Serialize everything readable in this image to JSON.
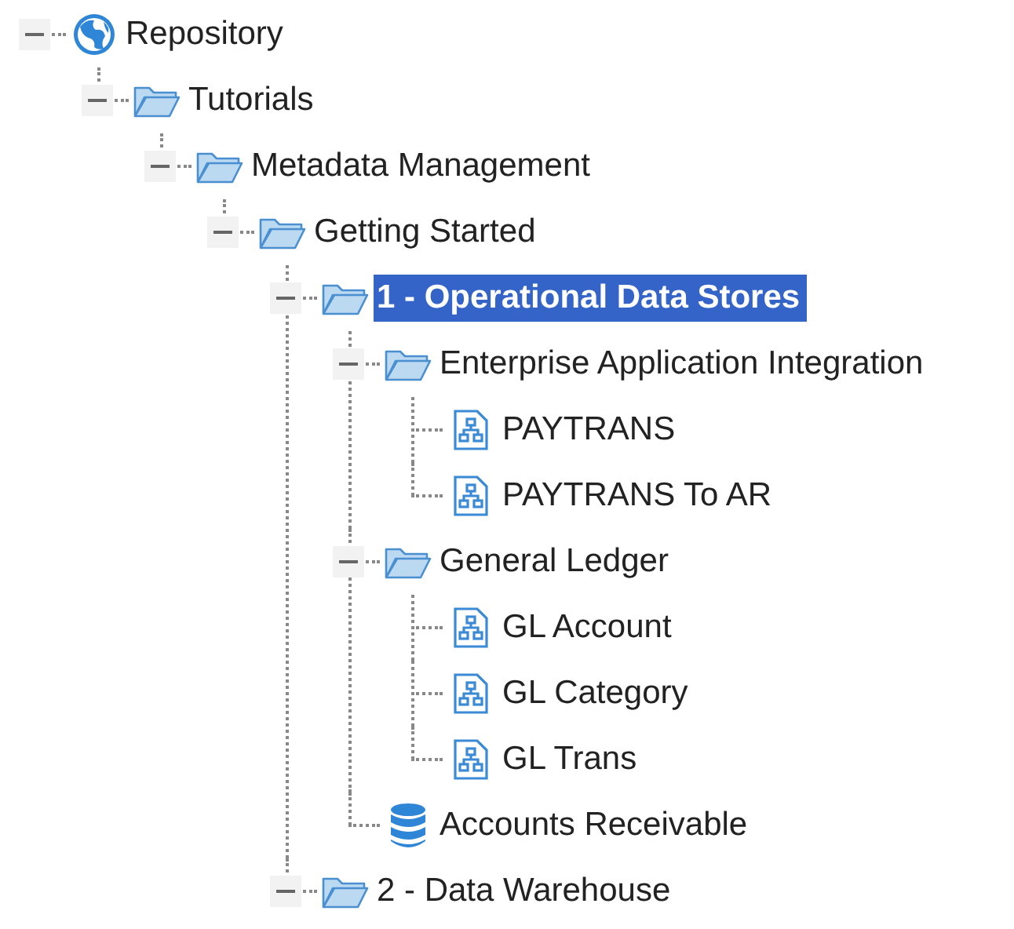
{
  "tree": [
    {
      "label": "Repository",
      "kind": "globe",
      "expanded": true,
      "selected": false,
      "children": [
        {
          "label": "Tutorials",
          "kind": "folder",
          "expanded": true,
          "selected": false,
          "children": [
            {
              "label": "Metadata Management",
              "kind": "folder",
              "expanded": true,
              "selected": false,
              "children": [
                {
                  "label": "Getting Started",
                  "kind": "folder",
                  "expanded": true,
                  "selected": false,
                  "children": [
                    {
                      "label": "1 - Operational Data Stores",
                      "kind": "folder",
                      "expanded": true,
                      "selected": true,
                      "children": [
                        {
                          "label": "Enterprise Application Integration",
                          "kind": "folder",
                          "expanded": true,
                          "selected": false,
                          "children": [
                            {
                              "label": "PAYTRANS",
                              "kind": "model",
                              "selected": false
                            },
                            {
                              "label": "PAYTRANS To AR",
                              "kind": "model",
                              "selected": false
                            }
                          ]
                        },
                        {
                          "label": "General Ledger",
                          "kind": "folder",
                          "expanded": true,
                          "selected": false,
                          "children": [
                            {
                              "label": "GL Account",
                              "kind": "model",
                              "selected": false
                            },
                            {
                              "label": "GL Category",
                              "kind": "model",
                              "selected": false
                            },
                            {
                              "label": "GL Trans",
                              "kind": "model",
                              "selected": false
                            }
                          ]
                        },
                        {
                          "label": "Accounts Receivable",
                          "kind": "database",
                          "selected": false
                        }
                      ]
                    },
                    {
                      "label": "2 - Data Warehouse",
                      "kind": "folder",
                      "expanded": true,
                      "selected": false
                    }
                  ]
                }
              ]
            }
          ]
        }
      ]
    }
  ]
}
